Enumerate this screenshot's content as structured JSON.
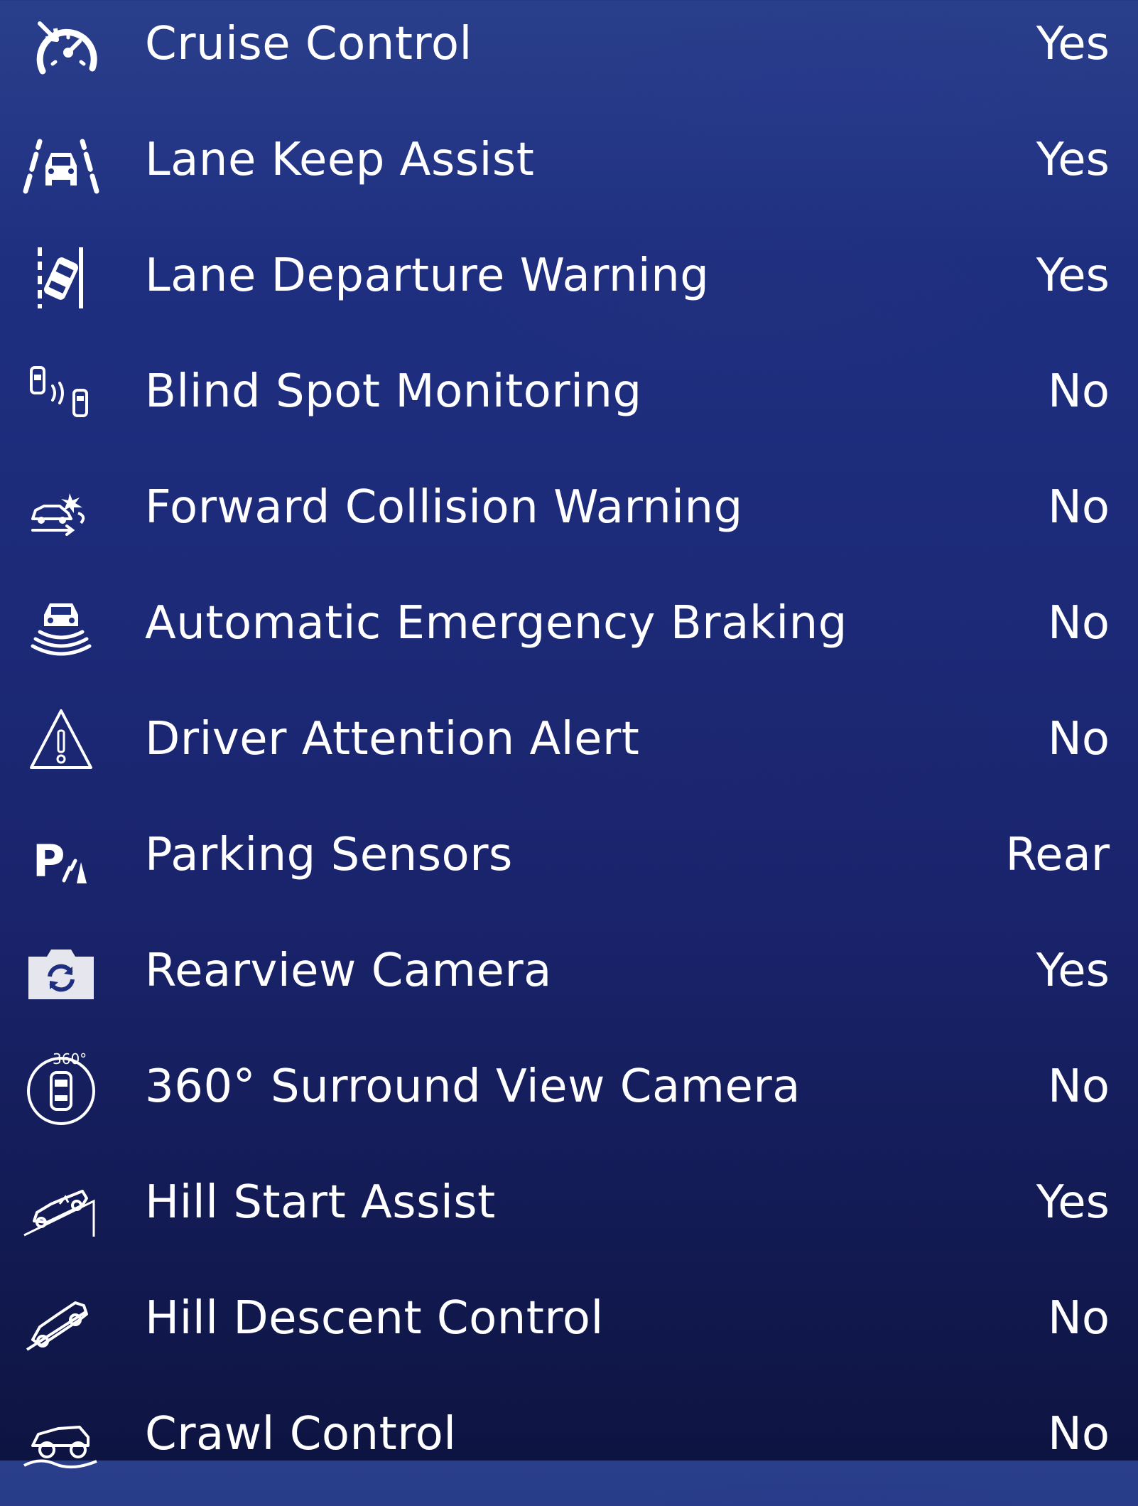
{
  "features": [
    {
      "label": "Cruise Control",
      "value": "Yes",
      "icon": "cruise-control-icon"
    },
    {
      "label": "Lane Keep Assist",
      "value": "Yes",
      "icon": "lane-keep-assist-icon"
    },
    {
      "label": "Lane Departure Warning",
      "value": "Yes",
      "icon": "lane-departure-icon"
    },
    {
      "label": "Blind Spot Monitoring",
      "value": "No",
      "icon": "blind-spot-icon"
    },
    {
      "label": "Forward Collision Warning",
      "value": "No",
      "icon": "forward-collision-icon"
    },
    {
      "label": "Automatic Emergency Braking",
      "value": "No",
      "icon": "emergency-braking-icon"
    },
    {
      "label": "Driver Attention Alert",
      "value": "No",
      "icon": "warning-triangle-icon"
    },
    {
      "label": "Parking Sensors",
      "value": "Rear",
      "icon": "parking-sensors-icon"
    },
    {
      "label": "Rearview Camera",
      "value": "Yes",
      "icon": "camera-icon"
    },
    {
      "label": "360° Surround View Camera",
      "value": "No",
      "icon": "surround-camera-icon"
    },
    {
      "label": "Hill Start Assist",
      "value": "Yes",
      "icon": "hill-start-icon"
    },
    {
      "label": "Hill Descent Control",
      "value": "No",
      "icon": "hill-descent-icon"
    },
    {
      "label": "Crawl Control",
      "value": "No",
      "icon": "crawl-control-icon"
    }
  ],
  "colors": {
    "text": "#ffffff",
    "background_top": "#2a3f8c",
    "background_bottom": "#0e1441"
  }
}
